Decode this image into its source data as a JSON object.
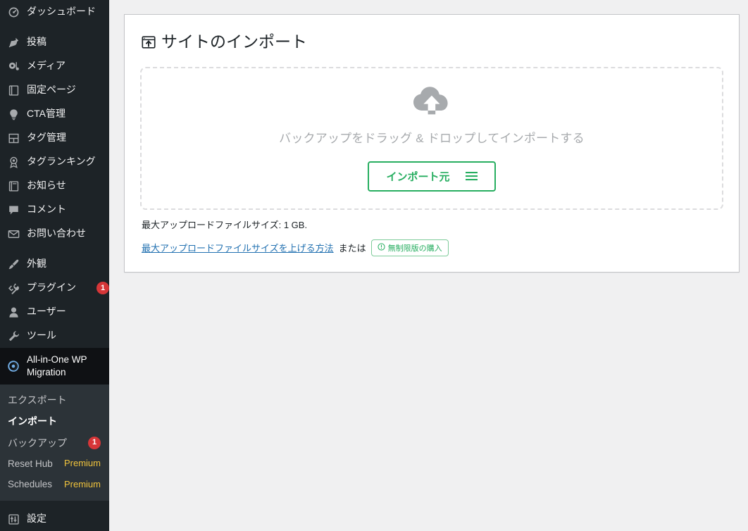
{
  "sidebar": {
    "items": [
      {
        "label": "ダッシュボード",
        "icon": "dashboard-icon",
        "sep": false,
        "badge": null
      },
      {
        "label": "投稿",
        "icon": "pin-icon",
        "sep": true,
        "badge": null
      },
      {
        "label": "メディア",
        "icon": "media-icon",
        "sep": false,
        "badge": null
      },
      {
        "label": "固定ページ",
        "icon": "page-icon",
        "sep": false,
        "badge": null
      },
      {
        "label": "CTA管理",
        "icon": "lightbulb-icon",
        "sep": false,
        "badge": null
      },
      {
        "label": "タグ管理",
        "icon": "tag-grid-icon",
        "sep": false,
        "badge": null
      },
      {
        "label": "タグランキング",
        "icon": "award-icon",
        "sep": false,
        "badge": null
      },
      {
        "label": "お知らせ",
        "icon": "book-icon",
        "sep": false,
        "badge": null
      },
      {
        "label": "コメント",
        "icon": "comment-icon",
        "sep": false,
        "badge": null
      },
      {
        "label": "お問い合わせ",
        "icon": "mail-icon",
        "sep": false,
        "badge": null
      },
      {
        "label": "外観",
        "icon": "brush-icon",
        "sep": true,
        "badge": null
      },
      {
        "label": "プラグイン",
        "icon": "plugin-icon",
        "sep": false,
        "badge": "1"
      },
      {
        "label": "ユーザー",
        "icon": "user-icon",
        "sep": false,
        "badge": null
      },
      {
        "label": "ツール",
        "icon": "wrench-icon",
        "sep": false,
        "badge": null
      }
    ],
    "active_item": {
      "label": "All-in-One WP Migration",
      "icon": "aiowpm-icon"
    },
    "submenu": [
      {
        "label": "エクスポート",
        "badge": null,
        "premium": null,
        "current": false,
        "small": false
      },
      {
        "label": "インポート",
        "badge": null,
        "premium": null,
        "current": true,
        "small": false
      },
      {
        "label": "バックアップ",
        "badge": "1",
        "premium": null,
        "current": false,
        "small": false
      },
      {
        "label": "Reset Hub",
        "badge": null,
        "premium": "Premium",
        "current": false,
        "small": true
      },
      {
        "label": "Schedules",
        "badge": null,
        "premium": "Premium",
        "current": false,
        "small": true
      }
    ],
    "after_items": [
      {
        "label": "設定",
        "icon": "settings-icon",
        "sep": true,
        "badge": null
      }
    ]
  },
  "page": {
    "title": "サイトのインポート",
    "title_icon": "import-box-icon"
  },
  "dropzone": {
    "icon": "cloud-upload-icon",
    "text": "バックアップをドラッグ & ドロップしてインポートする",
    "button_label": "インポート元",
    "button_icon": "hamburger-icon"
  },
  "footer": {
    "max_upload_text": "最大アップロードファイルサイズ: 1 GB.",
    "help_link": "最大アップロードファイルサイズを上げる方法",
    "or_text": "または",
    "pro_badge_label": "無制限版の購入",
    "pro_badge_icon": "info-circle-icon"
  },
  "colors": {
    "sidebar_bg": "#1d2327",
    "submenu_bg": "#2c3338",
    "accent_green": "#27ae60",
    "link_blue": "#2271b1",
    "badge_red": "#d63638",
    "premium_gold": "#f0c33c"
  }
}
